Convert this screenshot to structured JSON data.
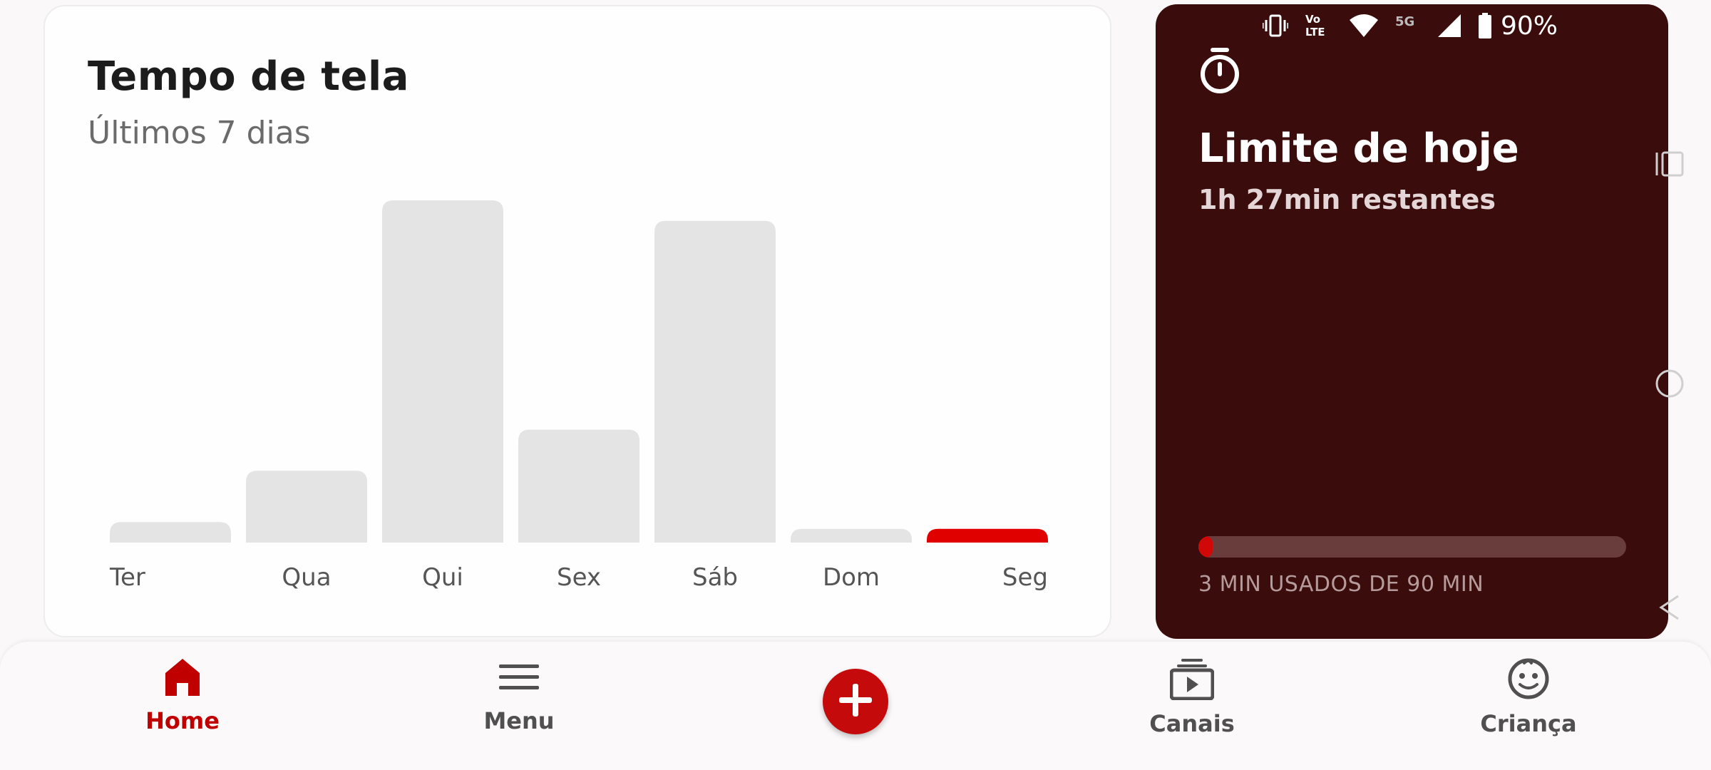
{
  "screen_time": {
    "title": "Tempo de tela",
    "subtitle": "Últimos 7 dias"
  },
  "chart_data": {
    "type": "bar",
    "categories": [
      "Ter",
      "Qua",
      "Qui",
      "Sex",
      "Sáb",
      "Dom",
      "Seg"
    ],
    "values": [
      6,
      21,
      100,
      33,
      94,
      4,
      4
    ],
    "highlight_index": 6,
    "bar_color": "#e4e4e4",
    "highlight_color": "#e00000",
    "title": "",
    "xlabel": "",
    "ylabel": ""
  },
  "status_bar": {
    "battery": "90%",
    "icons": [
      "vibrate-icon",
      "volte-icon",
      "wifi-icon",
      "5g-icon",
      "signal-icon",
      "battery-icon"
    ],
    "network_label": "5G",
    "volte_label_top": "Vo",
    "volte_label_bottom": "LTE"
  },
  "limit": {
    "title": "Limite de hoje",
    "remaining": "1h 27min restantes",
    "usage": "3 MIN USADOS DE 90 MIN",
    "used_fraction": 0.033,
    "background_color": "#3b0c0c",
    "accent_color": "#d10808"
  },
  "bottom_nav": {
    "items": [
      {
        "label": "Home",
        "icon": "home-icon",
        "active": true
      },
      {
        "label": "Menu",
        "icon": "menu-icon",
        "active": false
      },
      {
        "label": "Canais",
        "icon": "channels-icon",
        "active": false
      },
      {
        "label": "Criança",
        "icon": "child-face-icon",
        "active": false
      }
    ],
    "fab_icon": "plus-icon"
  }
}
